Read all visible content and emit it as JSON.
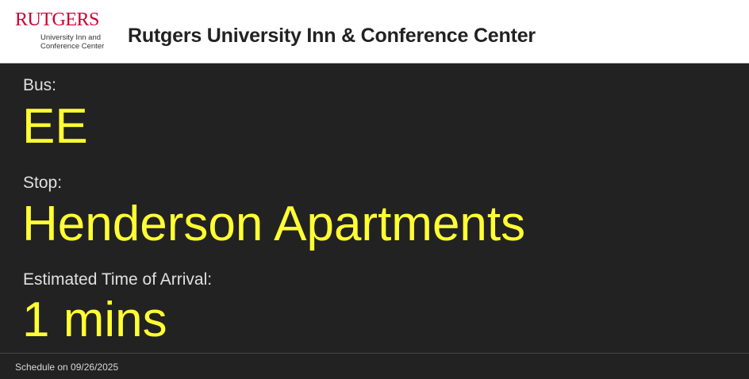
{
  "header": {
    "logo": {
      "wordmark": "RUTGERS",
      "subline1": "University Inn and",
      "subline2": "Conference Center"
    },
    "title": "Rutgers University Inn & Conference Center"
  },
  "main": {
    "bus_label": "Bus:",
    "bus_value": "EE",
    "stop_label": "Stop:",
    "stop_value": "Henderson Apartments",
    "eta_label": "Estimated Time of Arrival:",
    "eta_value": "1 mins"
  },
  "footer": {
    "schedule_text": "Schedule on 09/26/2025"
  },
  "colors": {
    "background": "#222222",
    "accent_yellow": "#ffff33",
    "brand_red": "#cc0033",
    "header_bg": "#ffffff"
  }
}
